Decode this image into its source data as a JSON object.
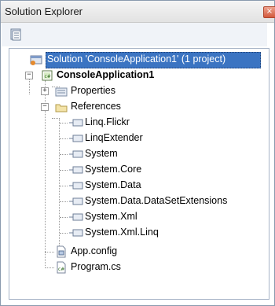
{
  "window": {
    "title": "Solution Explorer",
    "close_glyph": "×"
  },
  "toolbar": {
    "properties_icon": "properties-icon"
  },
  "tree": {
    "solution": "Solution 'ConsoleApplication1' (1 project)",
    "project": "ConsoleApplication1",
    "properties": "Properties",
    "references": "References",
    "reference_items": [
      "Linq.Flickr",
      "LinqExtender",
      "System",
      "System.Core",
      "System.Data",
      "System.Data.DataSetExtensions",
      "System.Xml",
      "System.Xml.Linq"
    ],
    "app_config": "App.config",
    "program": "Program.cs"
  },
  "colors": {
    "selection": "#3b74c2",
    "titlebar": "#e9e9e9",
    "toolbar": "#f0f3f8"
  }
}
